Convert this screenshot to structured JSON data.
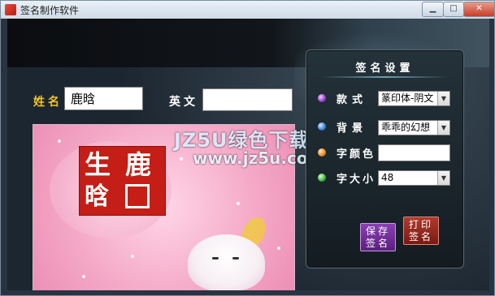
{
  "window": {
    "title": "签名制作软件",
    "controls": {
      "minimize": "▁",
      "maximize": "□",
      "close": "✕"
    }
  },
  "form": {
    "name_label": "姓名",
    "name_value": "鹿晗",
    "english_label": "英文",
    "english_value": ""
  },
  "preview": {
    "seal_chars": [
      "鹿",
      "生",
      "晗"
    ],
    "watermark_line1": "JZ5U绿色下载",
    "watermark_line2": "www.jz5u.com"
  },
  "settings_panel": {
    "title": "签名设置",
    "style_label": "款式",
    "style_value": "篆印体-阴文",
    "background_label": "背景",
    "background_value": "乖乖的幻想",
    "font_color_label": "字颜色",
    "font_size_label": "字大小",
    "font_size_value": "48",
    "save_button": "保存签名",
    "print_button": "打印签名"
  },
  "icons": {
    "style_bullet": "purple-orb",
    "background_bullet": "blue-orb",
    "color_bullet": "orange-orb",
    "size_bullet": "green-orb"
  }
}
